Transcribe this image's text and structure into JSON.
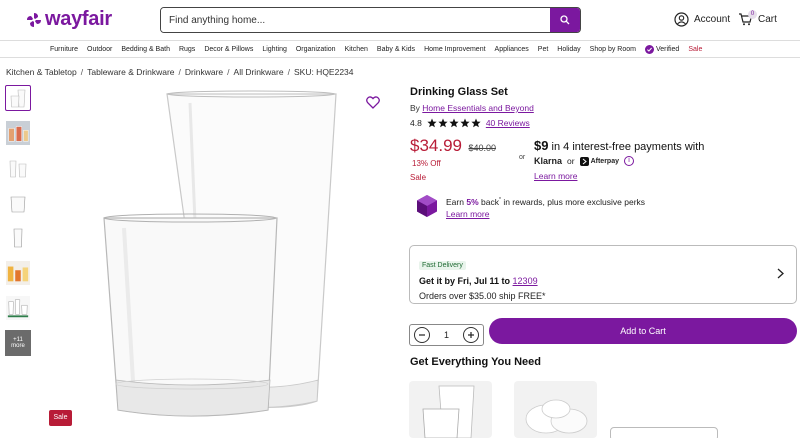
{
  "header": {
    "logo_text": "wayfair",
    "search_placeholder": "Find anything home...",
    "account_label": "Account",
    "cart_label": "Cart",
    "cart_count": "0"
  },
  "nav": {
    "items": [
      "Furniture",
      "Outdoor",
      "Bedding & Bath",
      "Rugs",
      "Decor & Pillows",
      "Lighting",
      "Organization",
      "Kitchen",
      "Baby & Kids",
      "Home Improvement",
      "Appliances",
      "Pet",
      "Holiday",
      "Shop by Room",
      "Verified",
      "Sale"
    ]
  },
  "breadcrumb": {
    "items": [
      "Kitchen & Tabletop",
      "Tableware & Drinkware",
      "Drinkware",
      "All Drinkware"
    ],
    "sku": "SKU: HQE2234"
  },
  "thumbnails": {
    "more_label_1": "+11",
    "more_label_2": "more"
  },
  "product": {
    "sale_tag": "Sale",
    "title": "Drinking Glass Set",
    "by_prefix": "By",
    "brand": "Home Essentials and Beyond",
    "rating_value": "4.8",
    "reviews_link": "40 Reviews",
    "price": "$34.99",
    "original_price": "$40.00",
    "percent_off": "13% Off",
    "sale_label": "Sale",
    "or_label": "or",
    "installment_amount": "$9",
    "installment_text": "in 4 interest-free payments with",
    "klarna_label": "Klarna",
    "klarna_or": "or",
    "afterpay_label": "Afterpay",
    "learn_more": "Learn more",
    "rewards_earn": "Earn",
    "rewards_percent": "5%",
    "rewards_back": "back",
    "rewards_rest": "in rewards, plus more exclusive perks",
    "rewards_learn_more": "Learn more"
  },
  "delivery": {
    "badge": "Fast Delivery",
    "line_prefix": "Get it by Fri, Jul 11 to",
    "zip": "12309",
    "free_ship": "Orders over $35.00 ship FREE*"
  },
  "purchase": {
    "quantity": "1",
    "add_to_cart": "Add to Cart"
  },
  "recommendations": {
    "heading": "Get Everything You Need"
  },
  "colors": {
    "brand_purple": "#7b189f",
    "sale_red": "#b81c37"
  }
}
